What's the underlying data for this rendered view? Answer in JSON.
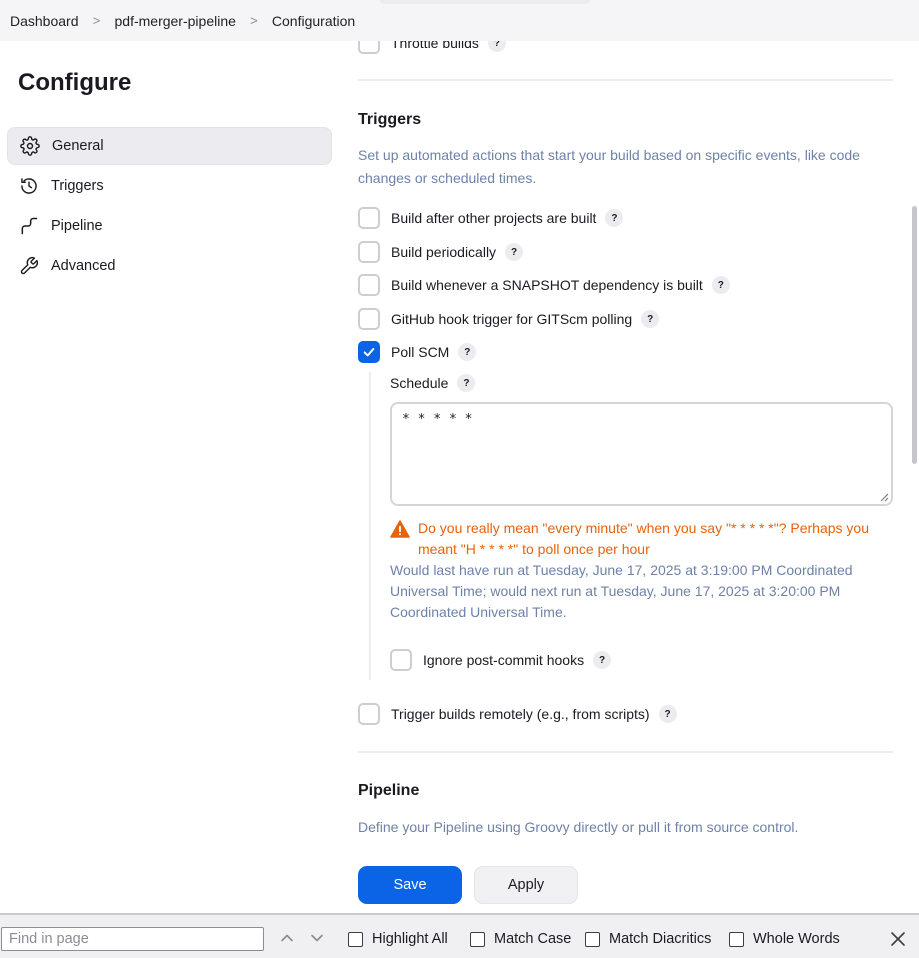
{
  "breadcrumb": {
    "items": [
      "Dashboard",
      "pdf-merger-pipeline",
      "Configuration"
    ],
    "separator": ">"
  },
  "sidebar": {
    "title": "Configure",
    "items": [
      {
        "label": "General",
        "icon": "gear-icon",
        "active": true
      },
      {
        "label": "Triggers",
        "icon": "clock-icon",
        "active": false
      },
      {
        "label": "Pipeline",
        "icon": "pipeline-icon",
        "active": false
      },
      {
        "label": "Advanced",
        "icon": "wrench-icon",
        "active": false
      }
    ]
  },
  "main": {
    "throttle_label": "Throttle builds",
    "triggers": {
      "title": "Triggers",
      "description": "Set up automated actions that start your build based on specific events, like code changes or scheduled times.",
      "options": [
        {
          "label": "Build after other projects are built",
          "checked": false
        },
        {
          "label": "Build periodically",
          "checked": false
        },
        {
          "label": "Build whenever a SNAPSHOT dependency is built",
          "checked": false
        },
        {
          "label": "GitHub hook trigger for GITScm polling",
          "checked": false
        },
        {
          "label": "Poll SCM",
          "checked": true
        }
      ],
      "schedule": {
        "label": "Schedule",
        "value": "* * * * *",
        "warning": "Do you really mean \"every minute\" when you say \"* * * * *\"? Perhaps you meant \"H * * * *\" to poll once per hour",
        "info": "Would last have run at Tuesday, June 17, 2025 at 3:19:00 PM Coordinated Universal Time; would next run at Tuesday, June 17, 2025 at 3:20:00 PM Coordinated Universal Time."
      },
      "ignore_hooks_label": "Ignore post-commit hooks",
      "remote_label": "Trigger builds remotely (e.g., from scripts)"
    },
    "pipeline": {
      "title": "Pipeline",
      "description": "Define your Pipeline using Groovy directly or pull it from source control."
    },
    "help_glyph": "?"
  },
  "buttons": {
    "save": "Save",
    "apply": "Apply"
  },
  "findbar": {
    "placeholder": "Find in page",
    "options": [
      "Highlight All",
      "Match Case",
      "Match Diacritics",
      "Whole Words"
    ]
  },
  "colors": {
    "accent": "#0b63e5",
    "warning": "#e8620a",
    "muted_text": "#6e82a8"
  }
}
